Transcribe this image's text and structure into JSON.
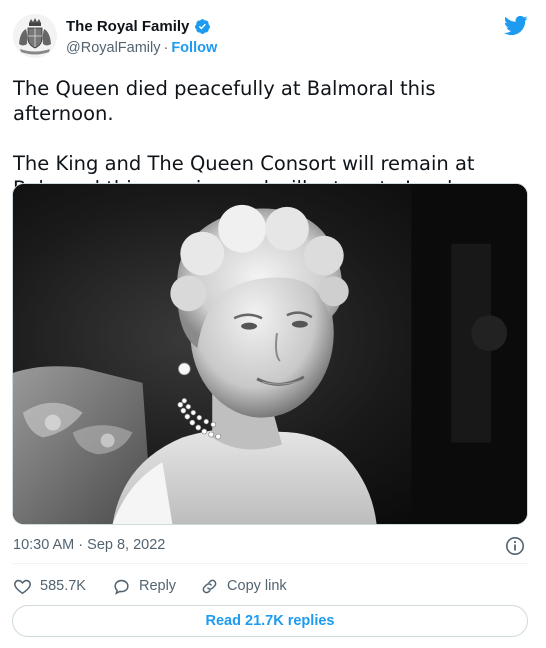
{
  "author": {
    "display_name": "The Royal Family",
    "handle": "@RoyalFamily",
    "separator": "·",
    "follow_label": "Follow",
    "verified_icon": "verified-badge-icon",
    "avatar_icon": "royal-coat-of-arms-icon"
  },
  "brand": {
    "logo_icon": "twitter-bird-icon",
    "accent_color": "#1d9bf0"
  },
  "tweet": {
    "paragraph_1": "The Queen died peacefully at Balmoral this afternoon.",
    "paragraph_2": "The King and The Queen Consort will remain at Balmoral this evening and will return to London tomorrow.",
    "media": {
      "type": "photo",
      "style": "black-and-white portrait"
    },
    "timestamp": "10:30 AM · Sep 8, 2022",
    "info_icon": "info-circle-icon"
  },
  "actions": {
    "like_count": "585.7K",
    "like_icon": "heart-icon",
    "reply_label": "Reply",
    "reply_icon": "speech-bubble-icon",
    "copy_link_label": "Copy link",
    "copy_link_icon": "link-icon"
  },
  "footer": {
    "read_replies_label": "Read 21.7K replies"
  },
  "colors": {
    "text_primary": "#0f1419",
    "text_secondary": "#536471",
    "border": "#cfd9de"
  }
}
